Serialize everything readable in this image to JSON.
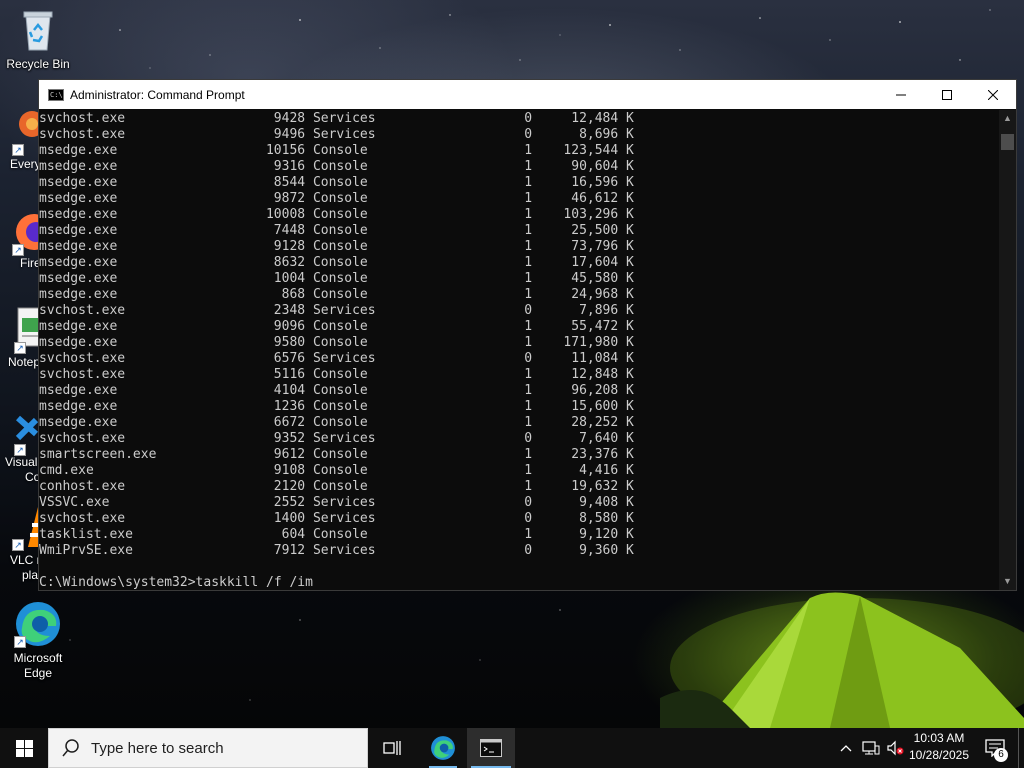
{
  "desktop": {
    "icons": [
      {
        "label": "Recycle Bin"
      },
      {
        "label": "Every"
      },
      {
        "label": "Fire"
      },
      {
        "label": "Notep"
      },
      {
        "label_line1": "Visual",
        "label_line2": "Co"
      },
      {
        "label_line1": "VLC r",
        "label_line2": "pla"
      },
      {
        "label_line1": "Microsoft",
        "label_line2": "Edge"
      }
    ]
  },
  "window": {
    "title": "Administrator: Command Prompt",
    "minimize_icon": "minimize-icon",
    "maximize_icon": "maximize-icon",
    "close_icon": "close-icon"
  },
  "console": {
    "rows": [
      {
        "name": "svchost.exe",
        "pid": "9428",
        "session": "Services",
        "num": "0",
        "mem": "12,484 K"
      },
      {
        "name": "svchost.exe",
        "pid": "9496",
        "session": "Services",
        "num": "0",
        "mem": "8,696 K"
      },
      {
        "name": "msedge.exe",
        "pid": "10156",
        "session": "Console",
        "num": "1",
        "mem": "123,544 K"
      },
      {
        "name": "msedge.exe",
        "pid": "9316",
        "session": "Console",
        "num": "1",
        "mem": "90,604 K"
      },
      {
        "name": "msedge.exe",
        "pid": "8544",
        "session": "Console",
        "num": "1",
        "mem": "16,596 K"
      },
      {
        "name": "msedge.exe",
        "pid": "9872",
        "session": "Console",
        "num": "1",
        "mem": "46,612 K"
      },
      {
        "name": "msedge.exe",
        "pid": "10008",
        "session": "Console",
        "num": "1",
        "mem": "103,296 K"
      },
      {
        "name": "msedge.exe",
        "pid": "7448",
        "session": "Console",
        "num": "1",
        "mem": "25,500 K"
      },
      {
        "name": "msedge.exe",
        "pid": "9128",
        "session": "Console",
        "num": "1",
        "mem": "73,796 K"
      },
      {
        "name": "msedge.exe",
        "pid": "8632",
        "session": "Console",
        "num": "1",
        "mem": "17,604 K"
      },
      {
        "name": "msedge.exe",
        "pid": "1004",
        "session": "Console",
        "num": "1",
        "mem": "45,580 K"
      },
      {
        "name": "msedge.exe",
        "pid": "868",
        "session": "Console",
        "num": "1",
        "mem": "24,968 K"
      },
      {
        "name": "svchost.exe",
        "pid": "2348",
        "session": "Services",
        "num": "0",
        "mem": "7,896 K"
      },
      {
        "name": "msedge.exe",
        "pid": "9096",
        "session": "Console",
        "num": "1",
        "mem": "55,472 K"
      },
      {
        "name": "msedge.exe",
        "pid": "9580",
        "session": "Console",
        "num": "1",
        "mem": "171,980 K"
      },
      {
        "name": "svchost.exe",
        "pid": "6576",
        "session": "Services",
        "num": "0",
        "mem": "11,084 K"
      },
      {
        "name": "svchost.exe",
        "pid": "5116",
        "session": "Console",
        "num": "1",
        "mem": "12,848 K"
      },
      {
        "name": "msedge.exe",
        "pid": "4104",
        "session": "Console",
        "num": "1",
        "mem": "96,208 K"
      },
      {
        "name": "msedge.exe",
        "pid": "1236",
        "session": "Console",
        "num": "1",
        "mem": "15,600 K"
      },
      {
        "name": "msedge.exe",
        "pid": "6672",
        "session": "Console",
        "num": "1",
        "mem": "28,252 K"
      },
      {
        "name": "svchost.exe",
        "pid": "9352",
        "session": "Services",
        "num": "0",
        "mem": "7,640 K"
      },
      {
        "name": "smartscreen.exe",
        "pid": "9612",
        "session": "Console",
        "num": "1",
        "mem": "23,376 K"
      },
      {
        "name": "cmd.exe",
        "pid": "9108",
        "session": "Console",
        "num": "1",
        "mem": "4,416 K"
      },
      {
        "name": "conhost.exe",
        "pid": "2120",
        "session": "Console",
        "num": "1",
        "mem": "19,632 K"
      },
      {
        "name": "VSSVC.exe",
        "pid": "2552",
        "session": "Services",
        "num": "0",
        "mem": "9,408 K"
      },
      {
        "name": "svchost.exe",
        "pid": "1400",
        "session": "Services",
        "num": "0",
        "mem": "8,580 K"
      },
      {
        "name": "tasklist.exe",
        "pid": "604",
        "session": "Console",
        "num": "1",
        "mem": "9,120 K"
      },
      {
        "name": "WmiPrvSE.exe",
        "pid": "7912",
        "session": "Services",
        "num": "0",
        "mem": "9,360 K"
      }
    ],
    "prompt": "C:\\Windows\\system32>",
    "command": "taskkill /f /im"
  },
  "taskbar": {
    "search_placeholder": "Type here to search",
    "time": "10:03 AM",
    "date": "10/28/2025",
    "notification_count": "6"
  }
}
